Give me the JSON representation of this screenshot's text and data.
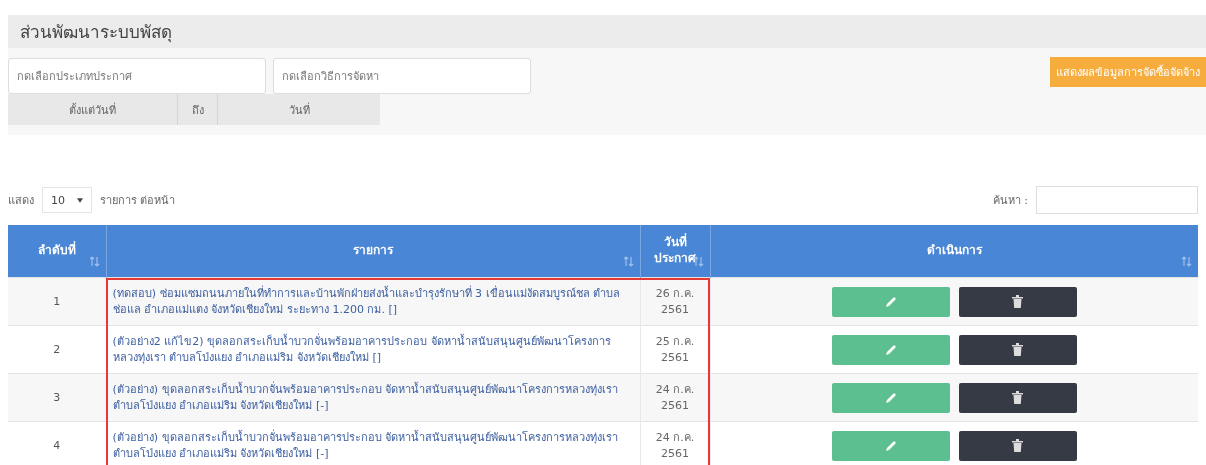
{
  "panel": {
    "title": "ส่วนพัฒนาระบบพัสดุ"
  },
  "filters": {
    "type_select": {
      "placeholder": "กดเลือกประเภทประกาศ"
    },
    "method_select": {
      "placeholder": "กดเลือกวิธีการจัดหา"
    },
    "show_button": "แสดงผลข้อมูลการจัดซื้อจัดจ้าง",
    "date_from_label": "ตั้งแต่วันที่",
    "date_to_label": "ถึง",
    "date_to_value": "วันที่"
  },
  "table_controls": {
    "show_label": "แสดง",
    "page_size": "10",
    "per_page_label": "รายการ ต่อหน้า",
    "search_label": "ค้นหา :"
  },
  "table": {
    "columns": [
      {
        "label": "ลำดับที่",
        "sortable": true
      },
      {
        "label": "รายการ",
        "sortable": true
      },
      {
        "label": "วันที่\nประกาศ",
        "sortable": true
      },
      {
        "label": "ดำเนินการ",
        "sortable": true
      }
    ],
    "highlight_frame": true,
    "rows": [
      {
        "no": "1",
        "title": "(ทดสอบ) ซ่อมแซมถนนภายในที่ทำการและบ้านพักฝ่ายส่งน้ำและบำรุงรักษาที่ 3 เขื่อนแม่งัดสมบูรณ์ชล ตำบลช่อแล อำเภอแม่แตง จังหวัดเชียงใหม่ ระยะทาง 1.200 กม. []",
        "date": "26 ก.ค.\n2561"
      },
      {
        "no": "2",
        "title": "(ตัวอย่าง2 แก้ไข2) ขุดลอกสระเก็บน้ำบวกจั่นพร้อมอาคารประกอบ จัดหาน้ำสนับสนุนศูนย์พัฒนาโครงการหลวงทุ่งเรา ตำบลโป่งแยง อำเภอแม่ริม จังหวัดเชียงใหม่ []",
        "date": "25 ก.ค.\n2561"
      },
      {
        "no": "3",
        "title": "(ตัวอย่าง) ขุดลอกสระเก็บน้ำบวกจั่นพร้อมอาคารประกอบ จัดหาน้ำสนับสนุนศูนย์พัฒนาโครงการหลวงทุ่งเรา ตำบลโป่งแยง อำเภอแม่ริม จังหวัดเชียงใหม่ [-]",
        "date": "24 ก.ค.\n2561"
      },
      {
        "no": "4",
        "title": "(ตัวอย่าง) ขุดลอกสระเก็บน้ำบวกจั่นพร้อมอาคารประกอบ จัดหาน้ำสนับสนุนศูนย์พัฒนาโครงการหลวงทุ่งเรา ตำบลโป่งแยง อำเภอแม่ริม จังหวัดเชียงใหม่ [-]",
        "date": "24 ก.ค.\n2561"
      }
    ]
  }
}
